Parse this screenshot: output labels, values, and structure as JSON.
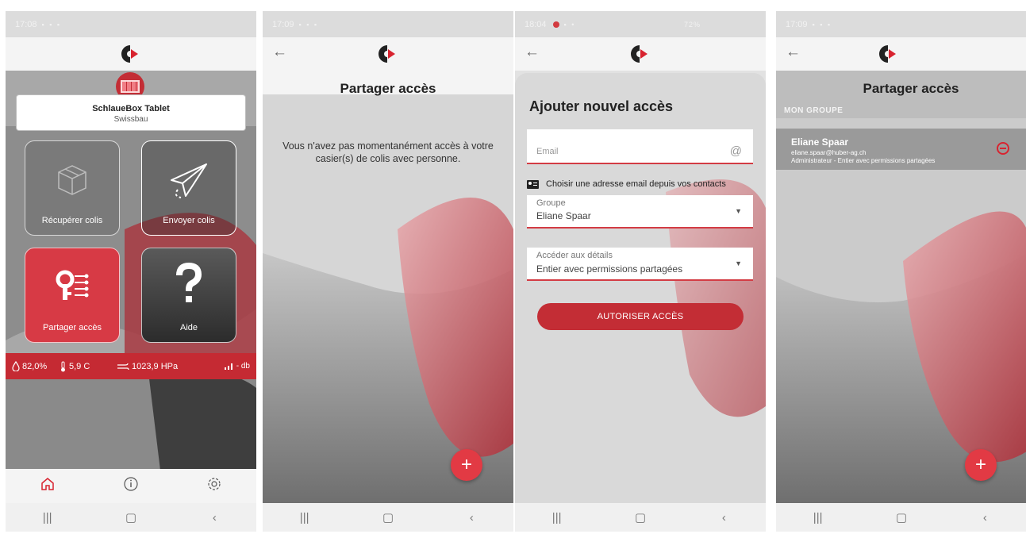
{
  "colors": {
    "brand_red": "#c32d35",
    "fab_red": "#e23a44",
    "sensor_bar": "#c52a33"
  },
  "screens": [
    {
      "status": {
        "time": "17:08"
      },
      "box": {
        "name": "SchlaueBox Tablet",
        "subtitle": "Swissbau"
      },
      "tiles": {
        "recuperer": "Récupérer colis",
        "envoyer": "Envoyer colis",
        "partager": "Partager accès",
        "aide": "Aide"
      },
      "sensors": {
        "humidity": "82,0%",
        "temperature": "5,9 C",
        "pressure": "1023,9 HPa",
        "signal": "- db"
      },
      "nav": [
        "home-icon",
        "info-icon",
        "settings-icon"
      ],
      "sysnav": [
        "|||",
        "▢",
        "‹"
      ]
    },
    {
      "status": {
        "time": "17:09"
      },
      "title": "Partager accès",
      "empty_message": "Vous n'avez pas momentanément accès à votre casier(s) de colis avec personne.",
      "fab": "+",
      "sysnav": [
        "|||",
        "▢",
        "‹"
      ]
    },
    {
      "status": {
        "time": "18:04",
        "battery": "72%"
      },
      "title": "Ajouter nouvel accès",
      "email": {
        "placeholder": "Email",
        "at": "@"
      },
      "contacts_link": "Choisir une adresse email depuis vos contacts",
      "groupe": {
        "label": "Groupe",
        "value": "Eliane Spaar"
      },
      "acces": {
        "label": "Accéder aux détails",
        "value": "Entier avec permissions partagées"
      },
      "submit": "AUTORISER ACCÈS",
      "sysnav": [
        "|||",
        "▢",
        "‹"
      ]
    },
    {
      "status": {
        "time": "17:09"
      },
      "title": "Partager accès",
      "group_header": "MON GROUPE",
      "member": {
        "name": "Eliane Spaar",
        "email": "eliane.spaar@huber-ag.ch",
        "role": "Administrateur - Entier avec permissions partagées"
      },
      "fab": "+",
      "sysnav": [
        "|||",
        "▢",
        "‹"
      ]
    }
  ]
}
